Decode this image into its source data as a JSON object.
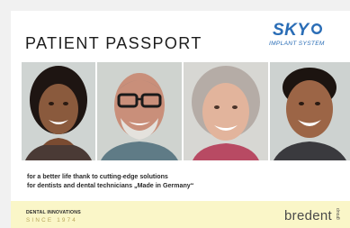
{
  "header": {
    "title": "PATIENT PASSPORT",
    "logo_main": "SKY",
    "logo_sub": "IMPLANT SYSTEM"
  },
  "photos": [
    {
      "label": "Smiling woman with dark curly hair"
    },
    {
      "label": "Smiling man with glasses and white beard"
    },
    {
      "label": "Smiling older woman with grey hair"
    },
    {
      "label": "Smiling young man with curly hair"
    }
  ],
  "tagline": {
    "line1": "for a better life thank to cutting-edge solutions",
    "line2": "for dentists and dental technicians „Made in Germany“"
  },
  "footer": {
    "main": "DENTAL INNOVATIONS",
    "since": "SINCE 1974",
    "brand": "bredent",
    "brand_suffix": "group"
  },
  "colors": {
    "brand_blue": "#2a6db6",
    "footer_bg": "#faf6c8",
    "since_gold": "#b9a65a"
  }
}
